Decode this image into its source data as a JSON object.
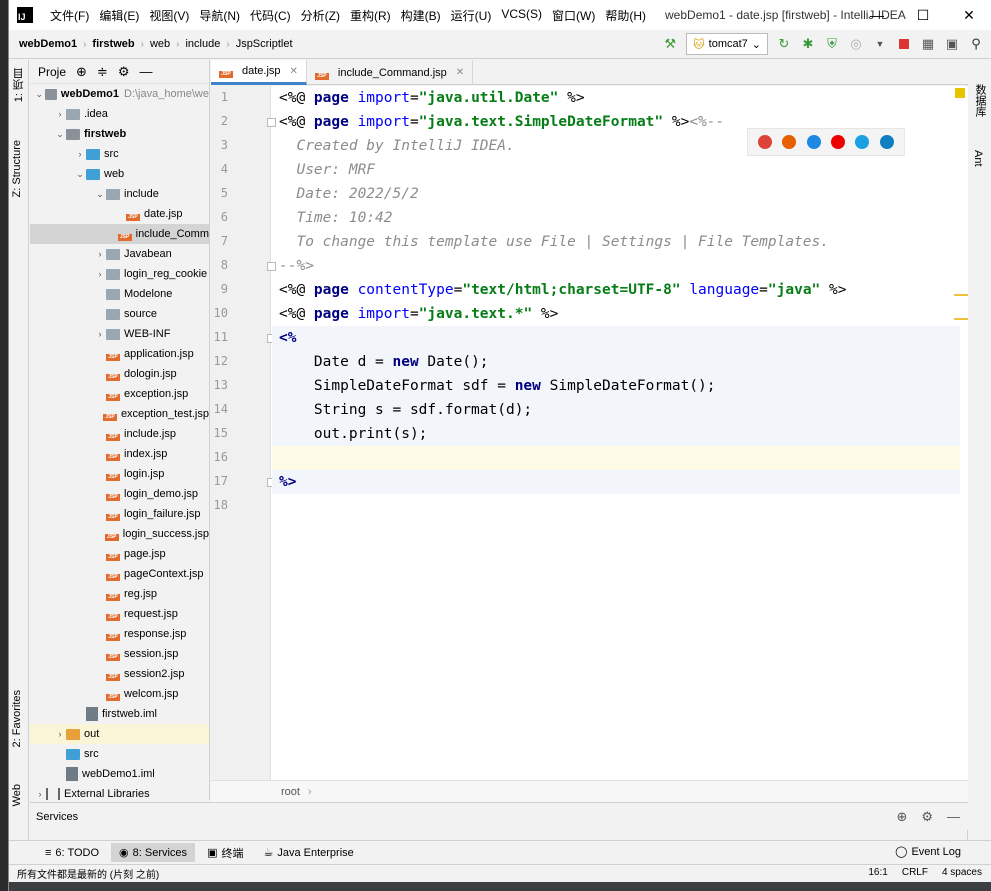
{
  "title_bar": {
    "logo": "IJ",
    "menu": [
      "文件(F)",
      "编辑(E)",
      "视图(V)",
      "导航(N)",
      "代码(C)",
      "分析(Z)",
      "重构(R)",
      "构建(B)",
      "运行(U)",
      "VCS(S)",
      "窗口(W)",
      "帮助(H)"
    ],
    "window_title": "webDemo1 - date.jsp [firstweb] - IntelliJ IDEA",
    "minimize": "—",
    "maximize": "☐",
    "close": "✕"
  },
  "navbar": {
    "breadcrumbs": [
      "webDemo1",
      "firstweb",
      "web",
      "include",
      "JspScriptlet"
    ],
    "run_config": "tomcat7"
  },
  "left_strip": {
    "project_tab": "1: 项目",
    "structure_tab": "Z: Structure",
    "favorites_tab": "2: Favorites",
    "web_tab": "Web"
  },
  "right_strip": {
    "database_tab": "数据库",
    "ant_tab": "Ant"
  },
  "project_panel": {
    "title": "Proje",
    "tree": [
      {
        "label": "webDemo1",
        "hint": "D:\\java_home\\we",
        "indent": 0,
        "arrow": "v",
        "icon": "folder-dark",
        "bold": true
      },
      {
        "label": ".idea",
        "indent": 1,
        "arrow": ">",
        "icon": "folder"
      },
      {
        "label": "firstweb",
        "indent": 1,
        "arrow": "v",
        "icon": "folder-dark",
        "bold": true
      },
      {
        "label": "src",
        "indent": 2,
        "arrow": ">",
        "icon": "folder-blue"
      },
      {
        "label": "web",
        "indent": 2,
        "arrow": "v",
        "icon": "folder-blue"
      },
      {
        "label": "include",
        "indent": 3,
        "arrow": "v",
        "icon": "folder"
      },
      {
        "label": "date.jsp",
        "indent": 4,
        "arrow": "",
        "icon": "jsp"
      },
      {
        "label": "include_Comm",
        "indent": 4,
        "arrow": "",
        "icon": "jsp",
        "selected": true
      },
      {
        "label": "Javabean",
        "indent": 3,
        "arrow": ">",
        "icon": "folder"
      },
      {
        "label": "login_reg_cookie",
        "indent": 3,
        "arrow": ">",
        "icon": "folder"
      },
      {
        "label": "Modelone",
        "indent": 3,
        "arrow": "",
        "icon": "folder"
      },
      {
        "label": "source",
        "indent": 3,
        "arrow": "",
        "icon": "folder"
      },
      {
        "label": "WEB-INF",
        "indent": 3,
        "arrow": ">",
        "icon": "folder"
      },
      {
        "label": "application.jsp",
        "indent": 3,
        "arrow": "",
        "icon": "jsp"
      },
      {
        "label": "dologin.jsp",
        "indent": 3,
        "arrow": "",
        "icon": "jsp"
      },
      {
        "label": "exception.jsp",
        "indent": 3,
        "arrow": "",
        "icon": "jsp"
      },
      {
        "label": "exception_test.jsp",
        "indent": 3,
        "arrow": "",
        "icon": "jsp"
      },
      {
        "label": "include.jsp",
        "indent": 3,
        "arrow": "",
        "icon": "jsp"
      },
      {
        "label": "index.jsp",
        "indent": 3,
        "arrow": "",
        "icon": "jsp"
      },
      {
        "label": "login.jsp",
        "indent": 3,
        "arrow": "",
        "icon": "jsp"
      },
      {
        "label": "login_demo.jsp",
        "indent": 3,
        "arrow": "",
        "icon": "jsp"
      },
      {
        "label": "login_failure.jsp",
        "indent": 3,
        "arrow": "",
        "icon": "jsp"
      },
      {
        "label": "login_success.jsp",
        "indent": 3,
        "arrow": "",
        "icon": "jsp"
      },
      {
        "label": "page.jsp",
        "indent": 3,
        "arrow": "",
        "icon": "jsp"
      },
      {
        "label": "pageContext.jsp",
        "indent": 3,
        "arrow": "",
        "icon": "jsp"
      },
      {
        "label": "reg.jsp",
        "indent": 3,
        "arrow": "",
        "icon": "jsp"
      },
      {
        "label": "request.jsp",
        "indent": 3,
        "arrow": "",
        "icon": "jsp"
      },
      {
        "label": "response.jsp",
        "indent": 3,
        "arrow": "",
        "icon": "jsp"
      },
      {
        "label": "session.jsp",
        "indent": 3,
        "arrow": "",
        "icon": "jsp"
      },
      {
        "label": "session2.jsp",
        "indent": 3,
        "arrow": "",
        "icon": "jsp"
      },
      {
        "label": "welcom.jsp",
        "indent": 3,
        "arrow": "",
        "icon": "jsp"
      },
      {
        "label": "firstweb.iml",
        "indent": 2,
        "arrow": "",
        "icon": "iml"
      },
      {
        "label": "out",
        "indent": 1,
        "arrow": ">",
        "icon": "folder-orange",
        "out": true
      },
      {
        "label": "src",
        "indent": 1,
        "arrow": "",
        "icon": "folder-blue"
      },
      {
        "label": "webDemo1.iml",
        "indent": 1,
        "arrow": "",
        "icon": "iml"
      },
      {
        "label": "External Libraries",
        "indent": 0,
        "arrow": ">",
        "icon": "libs"
      }
    ]
  },
  "editor_tabs": [
    {
      "label": "date.jsp",
      "active": true
    },
    {
      "label": "include_Command.jsp",
      "active": false
    }
  ],
  "editor": {
    "line_numbers": [
      "1",
      "2",
      "3",
      "4",
      "5",
      "6",
      "7",
      "8",
      "9",
      "10",
      "11",
      "12",
      "13",
      "14",
      "15",
      "16",
      "17",
      "18"
    ],
    "lines": [
      [
        [
          "c-dir",
          "<%@ "
        ],
        [
          "c-kw",
          "page "
        ],
        [
          "c-attr",
          "import"
        ],
        [
          "c-plain",
          "="
        ],
        [
          "c-str",
          "\"java.util.Date\""
        ],
        [
          "c-plain",
          " %>"
        ]
      ],
      [
        [
          "c-dir",
          "<%@ "
        ],
        [
          "c-kw",
          "page "
        ],
        [
          "c-attr",
          "import"
        ],
        [
          "c-plain",
          "="
        ],
        [
          "c-str",
          "\"java.text.SimpleDateFormat\""
        ],
        [
          "c-plain",
          " %>"
        ],
        [
          "c-cmt",
          "<%--"
        ]
      ],
      [
        [
          "c-cmt",
          "  Created by IntelliJ IDEA."
        ]
      ],
      [
        [
          "c-cmt",
          "  User: MRF"
        ]
      ],
      [
        [
          "c-cmt",
          "  Date: 2022/5/2"
        ]
      ],
      [
        [
          "c-cmt",
          "  Time: 10:42"
        ]
      ],
      [
        [
          "c-cmt",
          "  To change this template use File | Settings | File Templates."
        ]
      ],
      [
        [
          "c-cmt",
          "--%>"
        ]
      ],
      [
        [
          "c-dir",
          "<%@ "
        ],
        [
          "c-kw",
          "page "
        ],
        [
          "c-attr",
          "contentType"
        ],
        [
          "c-plain",
          "="
        ],
        [
          "c-str",
          "\"text/html;charset=UTF-8\""
        ],
        [
          "c-plain",
          " "
        ],
        [
          "c-attr",
          "language"
        ],
        [
          "c-plain",
          "="
        ],
        [
          "c-str",
          "\"java\""
        ],
        [
          "c-plain",
          " %>"
        ]
      ],
      [
        [
          "c-dir",
          "<%@ "
        ],
        [
          "c-kw",
          "page "
        ],
        [
          "c-attr",
          "import"
        ],
        [
          "c-plain",
          "="
        ],
        [
          "c-str",
          "\"java.text.*\""
        ],
        [
          "c-plain",
          " %>"
        ]
      ],
      [
        [
          "c-kw",
          "<%"
        ]
      ],
      [
        [
          "c-plain",
          "    Date d = "
        ],
        [
          "c-kw",
          "new "
        ],
        [
          "c-plain",
          "Date();"
        ]
      ],
      [
        [
          "c-plain",
          "    SimpleDateFormat sdf = "
        ],
        [
          "c-kw",
          "new "
        ],
        [
          "c-plain",
          "SimpleDateFormat();"
        ]
      ],
      [
        [
          "c-plain",
          "    String s = sdf.format(d);"
        ]
      ],
      [
        [
          "c-plain",
          "    out.print(s);"
        ]
      ],
      [
        [
          "c-plain",
          ""
        ]
      ],
      [
        [
          "c-kw",
          "%>"
        ]
      ],
      [
        [
          "c-plain",
          ""
        ]
      ]
    ],
    "browser_icons": [
      "chrome-icon",
      "firefox-icon",
      "safari-icon",
      "opera-icon",
      "ie-icon",
      "edge-icon"
    ]
  },
  "code_breadcrumb": "root",
  "services_label": "Services",
  "bottom_tabs": [
    {
      "label": "6: TODO",
      "active": false
    },
    {
      "label": "8: Services",
      "active": true
    },
    {
      "label": "终端",
      "active": false
    },
    {
      "label": "Java Enterprise",
      "active": false
    }
  ],
  "event_log": "Event Log",
  "status": {
    "message": "所有文件都是最新的 (片刻 之前)",
    "position": "16:1",
    "line_sep": "CRLF",
    "indent": "4 spaces"
  },
  "colors": {
    "accent": "#4083c9",
    "keyword": "#000080",
    "string": "#067d17",
    "comment": "#8c8c8c",
    "jsp_icon": "#e06b2c"
  }
}
